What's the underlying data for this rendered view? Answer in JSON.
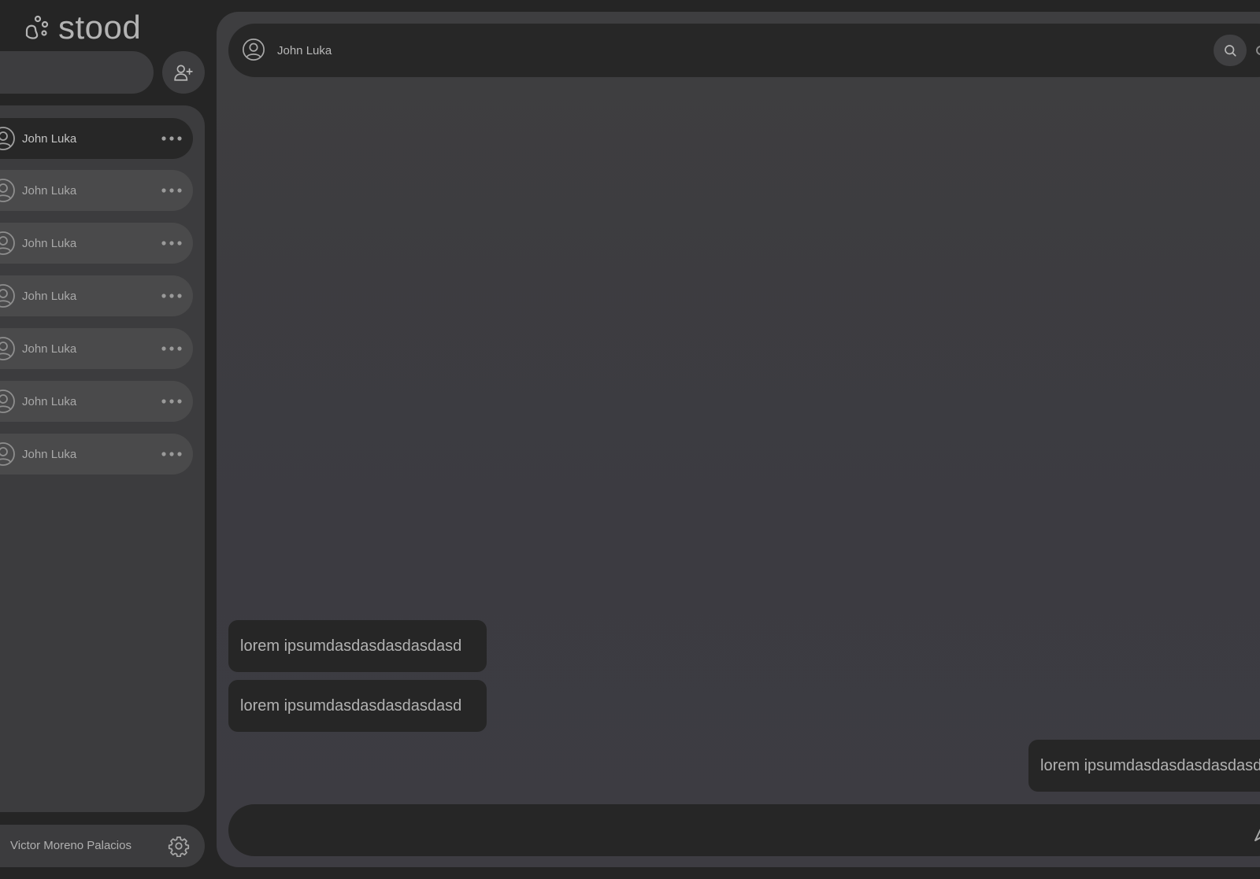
{
  "app": {
    "name": "stood"
  },
  "sidebar": {
    "search": {
      "placeholder": ""
    },
    "add_user": {
      "icon": "user-plus-icon"
    },
    "contacts": [
      {
        "name": "John Luka",
        "active": true
      },
      {
        "name": "John Luka",
        "active": false
      },
      {
        "name": "John Luka",
        "active": false
      },
      {
        "name": "John Luka",
        "active": false
      },
      {
        "name": "John Luka",
        "active": false
      },
      {
        "name": "John Luka",
        "active": false
      },
      {
        "name": "John Luka",
        "active": false
      }
    ],
    "current_user": {
      "name": "Victor Moreno Palacios",
      "icon": "gear-icon"
    }
  },
  "chat": {
    "header": {
      "name": "John Luka",
      "search_icon": "search-icon"
    },
    "messages": [
      {
        "text": "lorem ipsumdasdasdasdasdasd",
        "side": "left"
      },
      {
        "text": "lorem ipsumdasdasdasdasdasd",
        "side": "left"
      },
      {
        "text": "lorem ipsumdasdasdasdasdasd",
        "side": "right"
      }
    ],
    "composer": {
      "placeholder": "",
      "send_icon": "send-icon"
    }
  },
  "colors": {
    "background": "#252525",
    "panel": "#3c3c3e",
    "item": "#4a4a4b",
    "active_item": "#272727",
    "text": "#b8b8b8"
  }
}
